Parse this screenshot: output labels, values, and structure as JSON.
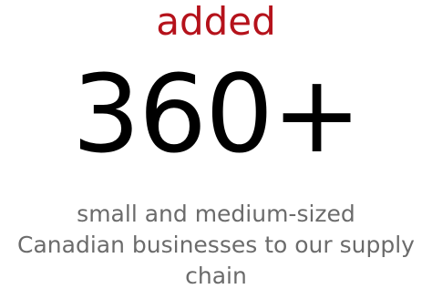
{
  "stat": {
    "lead": "added",
    "number": "360+",
    "description_lines": [
      "small and medium-sized",
      "Canadian businesses to our supply",
      "chain"
    ]
  },
  "colors": {
    "accent": "#b5121b",
    "number": "#000000",
    "description": "#6b6b6b",
    "background": "#ffffff"
  }
}
